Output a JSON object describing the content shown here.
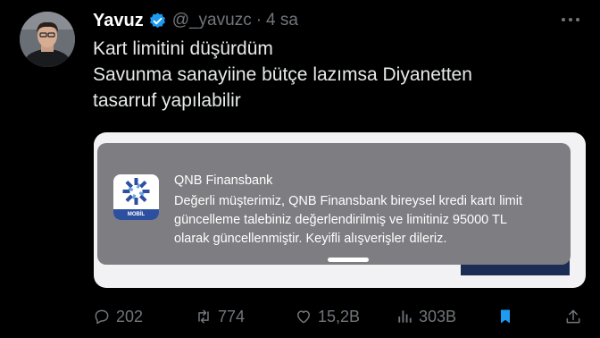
{
  "tweet": {
    "author_name": "Yavuz",
    "handle": "@_yavuzc",
    "separator": "·",
    "time": "4 sa",
    "lines": [
      "Kart limitini düşürdüm",
      "Savunma sanayiine bütçe lazımsa Diyanetten",
      "tasarruf yapılabilir"
    ]
  },
  "media": {
    "notification": {
      "app_icon_label": "MOBİL",
      "title": "QNB Finansbank",
      "body_lines": [
        "Değerli müşterimiz, QNB Finansbank bireysel kredi kartı limit",
        "güncelleme talebiniz değerlendirilmiş ve limitiniz 95000 TL",
        "olarak güncellenmiştir. Keyifli alışverişler dileriz."
      ]
    }
  },
  "actions": {
    "replies": "202",
    "retweets": "774",
    "likes": "15,2B",
    "views": "303B"
  },
  "icons": {
    "verified": "verified-badge-icon",
    "more": "more-icon",
    "reply": "reply-icon",
    "retweet": "retweet-icon",
    "like": "heart-icon",
    "views": "views-icon",
    "bookmark": "bookmark-icon",
    "share": "share-icon"
  },
  "colors": {
    "background": "#000000",
    "text": "#e7e9ea",
    "muted": "#71767b",
    "verified": "#1d9bf0",
    "bookmark_active": "#1d9bf0",
    "bank_blue": "#2c4fa0"
  }
}
